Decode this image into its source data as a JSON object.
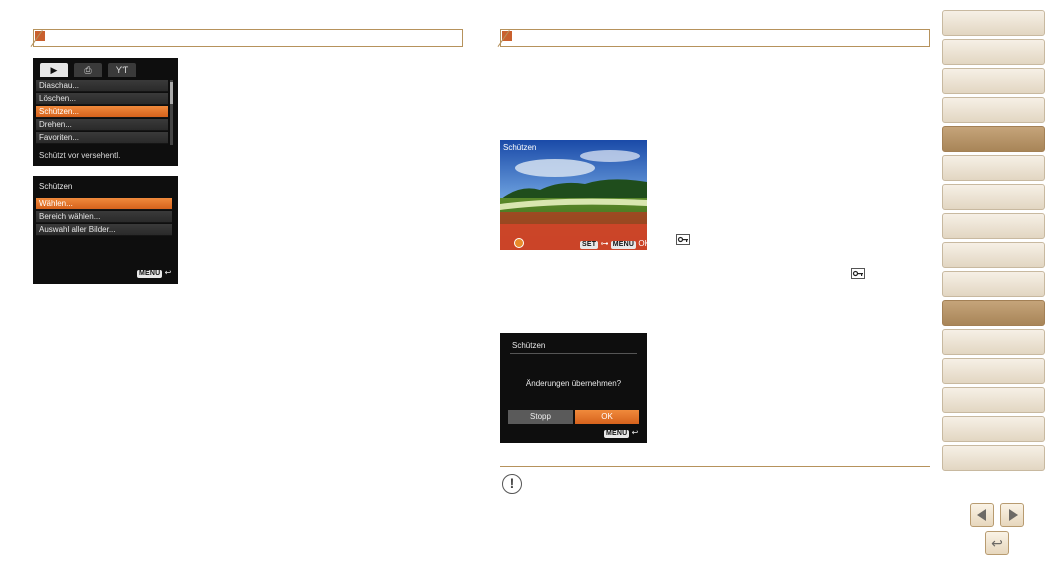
{
  "left_section": {
    "screen1": {
      "tabs": [
        "play-tab-icon",
        "print-tab-icon",
        "setup-tab-icon"
      ],
      "items": [
        "Diaschau...",
        "Löschen...",
        "Schützen...",
        "Drehen...",
        "Favoriten..."
      ],
      "selected_index": 2,
      "hint": "Schützt vor versehentl."
    },
    "screen2": {
      "title": "Schützen",
      "items": [
        "Wählen...",
        "Bereich wählen...",
        "Auswahl aller Bilder..."
      ],
      "selected_index": 0,
      "menu_badge": "MENU",
      "back_glyph": "↩"
    }
  },
  "right_section": {
    "photo_screen": {
      "title": "Schützen",
      "set_badge": "SET",
      "menu_badge": "MENU",
      "ok_label": "OK"
    },
    "dialog_screen": {
      "title": "Schützen",
      "question": "Änderungen übernehmen?",
      "stop_label": "Stopp",
      "ok_label": "OK",
      "menu_badge": "MENU",
      "back_glyph": "↩"
    },
    "caution_glyph": "!"
  },
  "sidebar": {
    "tab_count": 15,
    "active_indices": [
      4,
      10
    ]
  },
  "nav": {
    "prev_glyph": "◀",
    "next_glyph": "▶",
    "back_glyph": "↩"
  },
  "colors": {
    "accent_orange": "#d6621c",
    "header_square": "#c9602e",
    "border_gold": "#b6925c",
    "side_tab_active": "#b8956a"
  }
}
